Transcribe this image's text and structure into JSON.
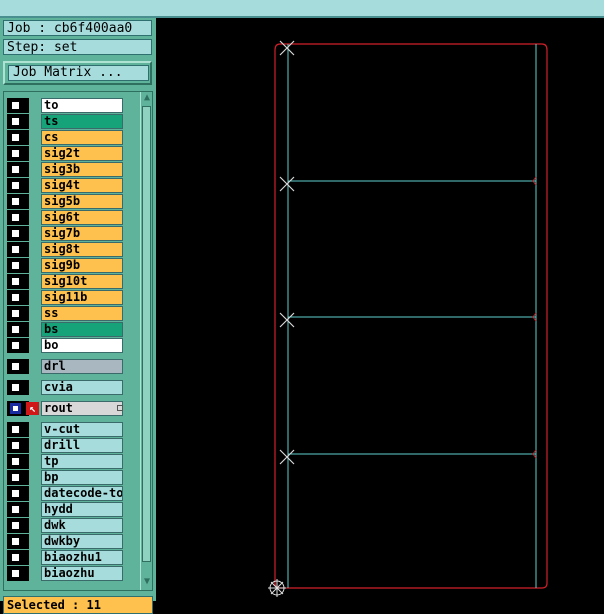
{
  "job_label": "Job : cb6f400aa0",
  "step_label": "Step: set",
  "job_matrix_button": "Job Matrix ...",
  "layers": [
    {
      "name": "to",
      "color": "#ffffff"
    },
    {
      "name": "ts",
      "color": "#17a37a"
    },
    {
      "name": "cs",
      "color": "#ffc14d"
    },
    {
      "name": "sig2t",
      "color": "#ffc14d"
    },
    {
      "name": "sig3b",
      "color": "#ffc14d"
    },
    {
      "name": "sig4t",
      "color": "#ffc14d"
    },
    {
      "name": "sig5b",
      "color": "#ffc14d"
    },
    {
      "name": "sig6t",
      "color": "#ffc14d"
    },
    {
      "name": "sig7b",
      "color": "#ffc14d"
    },
    {
      "name": "sig8t",
      "color": "#ffc14d"
    },
    {
      "name": "sig9b",
      "color": "#ffc14d"
    },
    {
      "name": "sig10t",
      "color": "#ffc14d"
    },
    {
      "name": "sig11b",
      "color": "#ffc14d"
    },
    {
      "name": "ss",
      "color": "#ffc14d"
    },
    {
      "name": "bs",
      "color": "#17a37a"
    },
    {
      "name": "bo",
      "color": "#ffffff"
    },
    {
      "name": "drl",
      "color": "#a9b8c0"
    },
    {
      "name": "cvia",
      "color": "#a6dcdc"
    },
    {
      "name": "rout",
      "color": "#d8d8d8"
    },
    {
      "name": "v-cut",
      "color": "#a6dcdc"
    },
    {
      "name": "drill",
      "color": "#a6dcdc"
    },
    {
      "name": "tp",
      "color": "#a6dcdc"
    },
    {
      "name": "bp",
      "color": "#a6dcdc"
    },
    {
      "name": "datecode-to",
      "color": "#a6dcdc"
    },
    {
      "name": "hydd",
      "color": "#a6dcdc"
    },
    {
      "name": "dwk",
      "color": "#a6dcdc"
    },
    {
      "name": "dwkby",
      "color": "#a6dcdc"
    },
    {
      "name": "biaozhu1",
      "color": "#a6dcdc"
    },
    {
      "name": "biaozhu",
      "color": "#a6dcdc"
    }
  ],
  "selected_label": "Selected : 11",
  "colors": {
    "panel": "#5fb39b",
    "board_outline": "#d0202a",
    "profile_line": "#5fd0d0",
    "background": "#000000"
  },
  "icons": {
    "rout_left": "blue-square-icon",
    "rout_right": "red-arrow-icon",
    "origin": "origin-crosshair-icon"
  }
}
